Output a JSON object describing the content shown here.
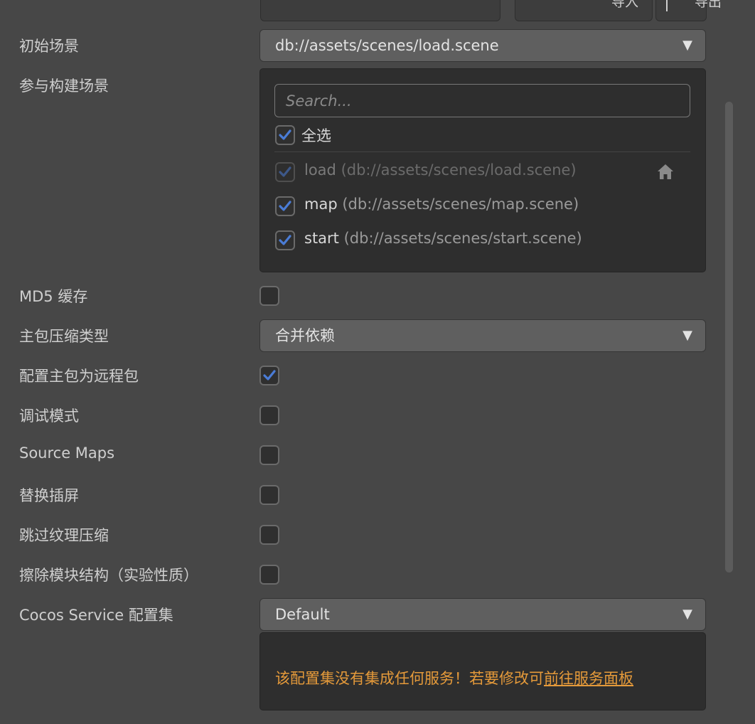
{
  "top": {
    "import_label": "导入",
    "export_label": "导出"
  },
  "fields": {
    "start_scene_label": "初始场景",
    "start_scene_value": "db://assets/scenes/load.scene",
    "build_scenes_label": "参与构建场景",
    "md5_label": "MD5 缓存",
    "compress_label": "主包压缩类型",
    "compress_value": "合并依赖",
    "remote_label": "配置主包为远程包",
    "debug_label": "调试模式",
    "sourcemaps_label": "Source Maps",
    "splash_label": "替换插屏",
    "skip_tex_label": "跳过纹理压缩",
    "erase_module_label": "擦除模块结构（实验性质）",
    "service_label": "Cocos Service 配置集",
    "service_value": "Default"
  },
  "scenes": {
    "search_placeholder": "Search...",
    "select_all_label": "全选",
    "items": [
      {
        "name": "load",
        "path": "(db://assets/scenes/load.scene)",
        "checked": true,
        "disabled": true
      },
      {
        "name": "map",
        "path": "(db://assets/scenes/map.scene)",
        "checked": true,
        "disabled": false
      },
      {
        "name": "start",
        "path": "(db://assets/scenes/start.scene)",
        "checked": true,
        "disabled": false
      }
    ]
  },
  "checks": {
    "md5": false,
    "remote": true,
    "debug": false,
    "sourcemaps": false,
    "splash": false,
    "skip_tex": false,
    "erase_module": false
  },
  "service": {
    "message": "该配置集没有集成任何服务！若要修改可",
    "link": "前往服务面板"
  },
  "colors": {
    "background": "#474747",
    "checkmark": "#4a7cd6",
    "warning": "#e59a3a"
  },
  "icons": {
    "dropdown": "triangle-down",
    "home": "home"
  }
}
